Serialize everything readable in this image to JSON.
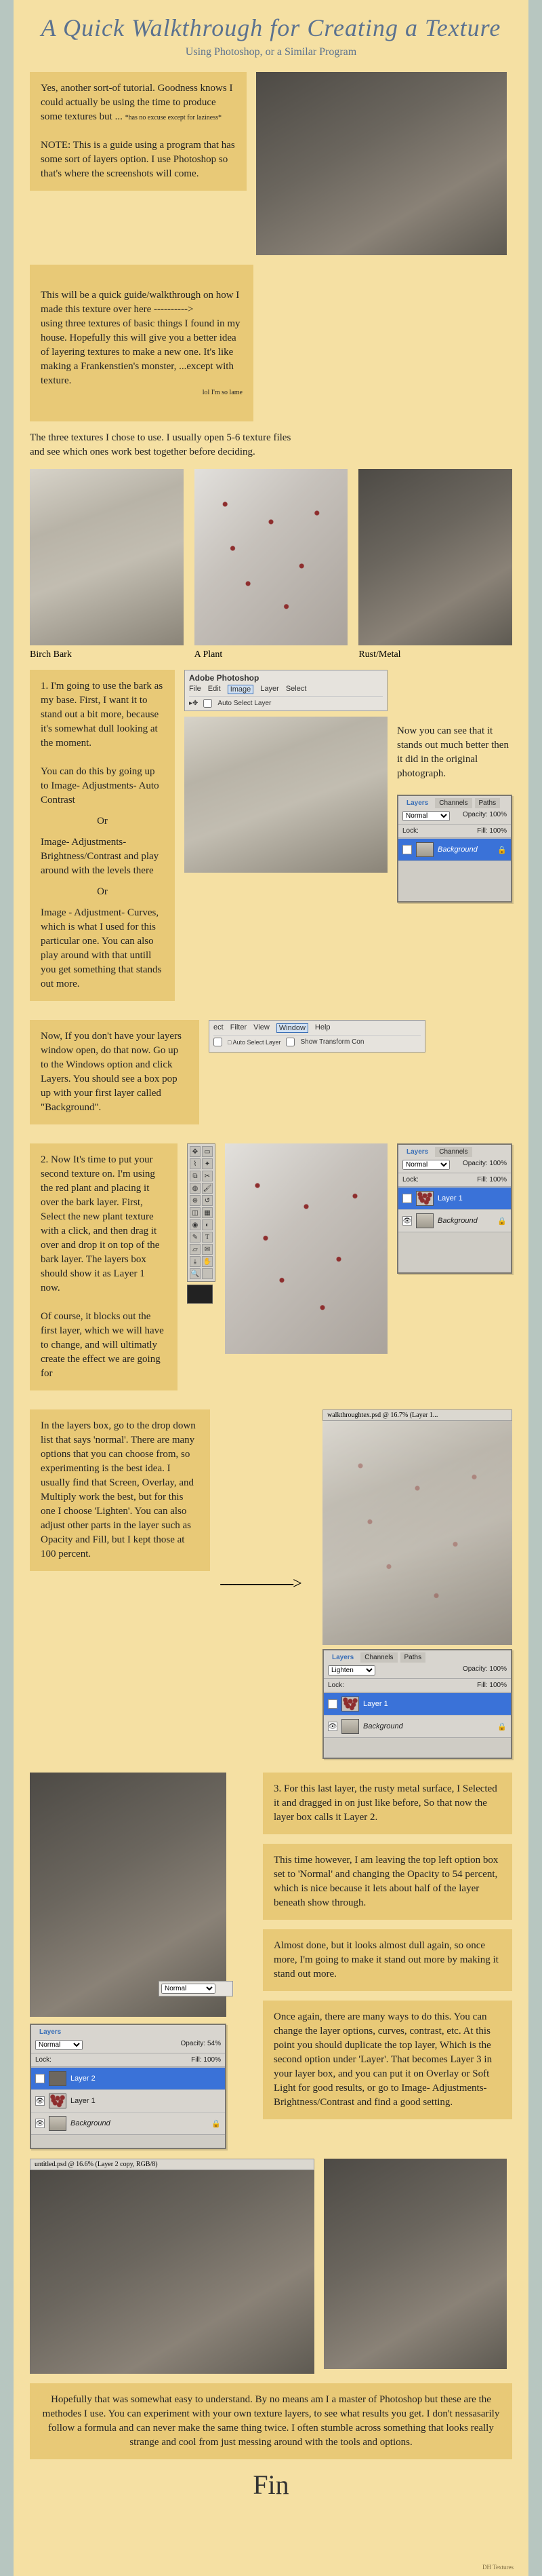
{
  "title": "A Quick Walkthrough for Creating a Texture",
  "subtitle": "Using Photoshop, or a Similar Program",
  "intro_box": "Yes, another sort-of tutorial. Goodness knows I could actually be using the time to produce some textures but ...",
  "intro_small": "*has no excuse except for laziness*",
  "intro_note": "NOTE: This is a guide using a program that has some sort of layers option. I use Photoshop so that's where the screenshots will come.",
  "bridge_box": "This will be a quick guide/walkthrough on how I made this texture over here ---------->\nusing three textures of basic things I found in my house. Hopefully this will give you a better idea of layering textures to make a new one. It's like making a Frankenstien's monster, ...except with texture.",
  "bridge_small": "lol I'm so lame",
  "choose_text": "The three textures I chose to use. I usually open 5-6 texture files and see which ones work best together before deciding.",
  "captions": {
    "bark": "Birch Bark",
    "plant": "A Plant",
    "rust": "Rust/Metal"
  },
  "step1": {
    "a": "1. I'm going to use the bark as my base. First, I want it to stand out a bit more, because it's somewhat dull looking at the moment.",
    "b": "You can do this by going up to Image- Adjustments- Auto Contrast",
    "or": "Or",
    "c": "Image- Adjustments- Brightness/Contrast and play around with the levels there",
    "d": "Image - Adjustment- Curves, which is what I used for this particular one. You can also play around with that untill you get something that stands out more.",
    "side": "Now you can see that it stands out much better then it did in the original photograph."
  },
  "layers_box": "Now, If you don't have your layers window open, do that now. Go up to the Windows option and click Layers. You should see a box pop up with your first layer called \"Background\".",
  "step2": {
    "a": "2. Now It's time to put your second texture on. I'm using the red plant and placing it over the bark layer. First, Select the new plant texture with a click, and then drag it over and drop it on top of the bark layer. The layers box should show it as Layer 1 now.",
    "b": "Of course, it blocks out the first layer, which we will have to change, and will ultimatly create the effect we are going for"
  },
  "blend_box": "In the layers box, go to the drop down list that says 'normal'. There are many options that you can choose from, so experimenting is the best idea. I usually find that Screen, Overlay, and Multiply work the best, but for this one I choose 'Lighten'. You can also adjust other parts in the layer such as Opacity and Fill, but I kept those at 100 percent.",
  "arrow": "------------------>",
  "step3": {
    "a": "3. For this last layer, the rusty metal surface, I Selected it and dragged in on just like before, So that now the layer box calls it Layer 2.",
    "b": "This time however, I am leaving the top left option box set to 'Normal' and changing the Opacity to 54 percent, which is nice because it lets about half of the layer beneath show through.",
    "c": "Almost done, but it looks almost dull again, so once more, I'm going to make it stand out more by making it stand out more.",
    "d": "Once again, there are many ways to do this. You can change the layer options, curves, contrast, etc. At this point you should duplicate the top layer, Which is the second option under 'Layer'. That becomes Layer 3 in your layer box, and you can put it on Overlay or Soft Light for good results, or go to Image- Adjustments- Brightness/Contrast and find a good setting."
  },
  "closing": "Hopefully that was somewhat easy to understand. By no means am I a master of Photoshop but these are the methodes I use. You can experiment with your own texture layers, to see what results you get. I don't nessasarily follow a formula and can never make the same thing twice. I often stumble across something that looks really strange and cool from just messing around with the tools and options.",
  "sig": "Fin",
  "credit": "DH Textures",
  "ps": {
    "title": "Adobe Photoshop",
    "menu": [
      "File",
      "Edit",
      "Image",
      "Layer",
      "Select"
    ],
    "submenu_auto": "Auto Select Layer",
    "windows_menu": [
      "ect",
      "Filter",
      "View",
      "Window",
      "Help"
    ],
    "transform": "Show Transform Con",
    "layers_tab": "Layers",
    "channels_tab": "Channels",
    "paths_tab": "Paths",
    "normal": "Normal",
    "lighten": "Lighten",
    "opacity100": "Opacity: 100%",
    "opacity54": "Opacity: 54%",
    "fill100": "Fill: 100%",
    "lock": "Lock:",
    "background": "Background",
    "layer1": "Layer 1",
    "layer2": "Layer 2",
    "doc_title": "walkthroughtex.psd @ 16.7% (Layer 1..."
  }
}
